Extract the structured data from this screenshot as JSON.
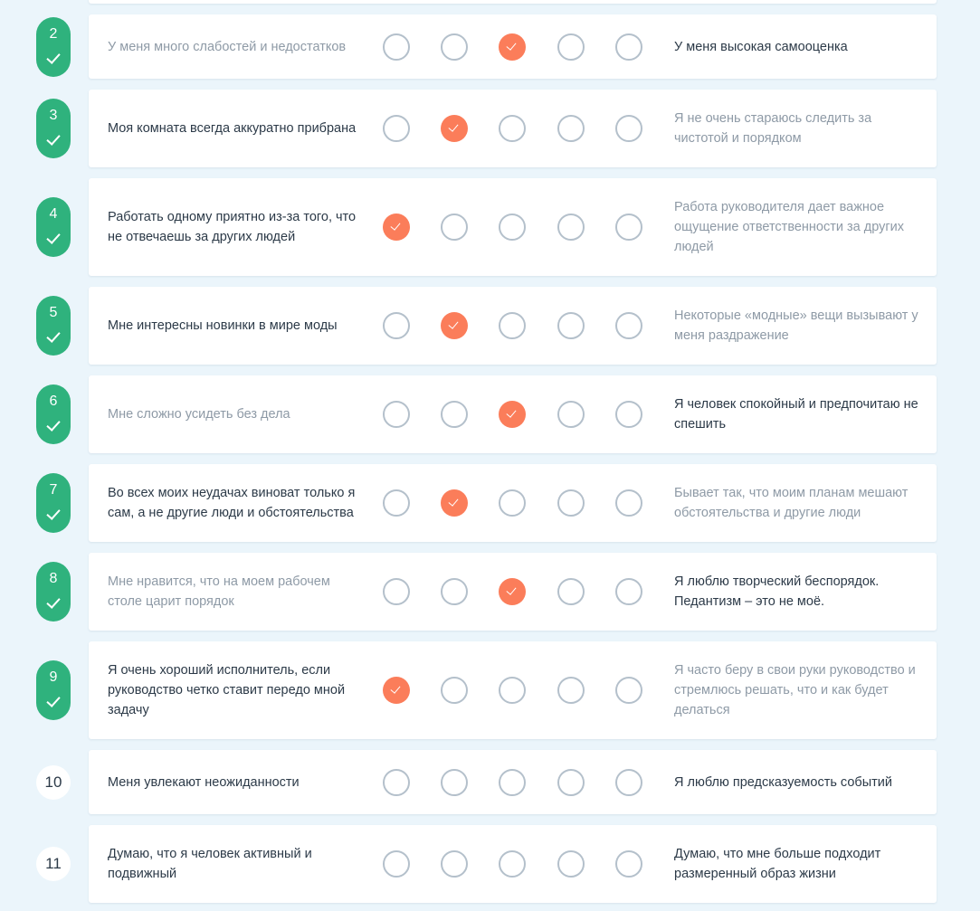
{
  "questions": [
    {
      "number": "2",
      "done": true,
      "left": "У меня много слабостей и недостатков",
      "right": "У меня высокая самооценка",
      "selected": 3,
      "left_strong": false,
      "right_strong": true
    },
    {
      "number": "3",
      "done": true,
      "left": "Моя комната всегда аккуратно прибрана",
      "right": "Я не очень стараюсь следить за чистотой и порядком",
      "selected": 2,
      "left_strong": true,
      "right_strong": false
    },
    {
      "number": "4",
      "done": true,
      "left": "Работать одному приятно из-за того, что не отвечаешь за других людей",
      "right": "Работа руководителя дает важное ощущение ответственности за других людей",
      "selected": 1,
      "left_strong": true,
      "right_strong": false
    },
    {
      "number": "5",
      "done": true,
      "left": "Мне интересны новинки в мире моды",
      "right": "Некоторые «модные» вещи вызывают у меня раздражение",
      "selected": 2,
      "left_strong": true,
      "right_strong": false
    },
    {
      "number": "6",
      "done": true,
      "left": "Мне сложно усидеть без дела",
      "right": "Я человек спокойный и предпочитаю не спешить",
      "selected": 3,
      "left_strong": false,
      "right_strong": true
    },
    {
      "number": "7",
      "done": true,
      "left": "Во всех моих неудачах виноват только я сам, а не другие люди и обстоятельства",
      "right": "Бывает так, что моим планам мешают обстоятельства и другие люди",
      "selected": 2,
      "left_strong": true,
      "right_strong": false
    },
    {
      "number": "8",
      "done": true,
      "left": "Мне нравится, что на моем рабочем столе царит порядок",
      "right": "Я люблю творческий беспорядок. Педантизм – это не моё.",
      "selected": 3,
      "left_strong": false,
      "right_strong": true
    },
    {
      "number": "9",
      "done": true,
      "left": "Я очень хороший исполнитель, если руководство четко ставит передо мной задачу",
      "right": "Я часто беру в свои руки руководство и стремлюсь решать, что и как будет делаться",
      "selected": 1,
      "left_strong": true,
      "right_strong": false
    },
    {
      "number": "10",
      "done": false,
      "left": "Меня увлекают неожиданности",
      "right": "Я люблю предсказуемость событий",
      "selected": 0,
      "left_strong": true,
      "right_strong": true
    },
    {
      "number": "11",
      "done": false,
      "left": "Думаю, что я человек активный и подвижный",
      "right": "Думаю, что мне больше подходит размеренный образ жизни",
      "selected": 0,
      "left_strong": true,
      "right_strong": true
    }
  ],
  "scale_points": 5,
  "colors": {
    "background": "#ebf5fb",
    "card": "#ffffff",
    "badge_done": "#2fb27d",
    "selected_option": "#fb7d5a",
    "option_border": "#b4c0cb",
    "text_strong": "#2c3a48",
    "text_weak": "#8e9aa6"
  },
  "icons": {
    "badge_check": "check-icon",
    "selected_option_check": "check-icon"
  }
}
